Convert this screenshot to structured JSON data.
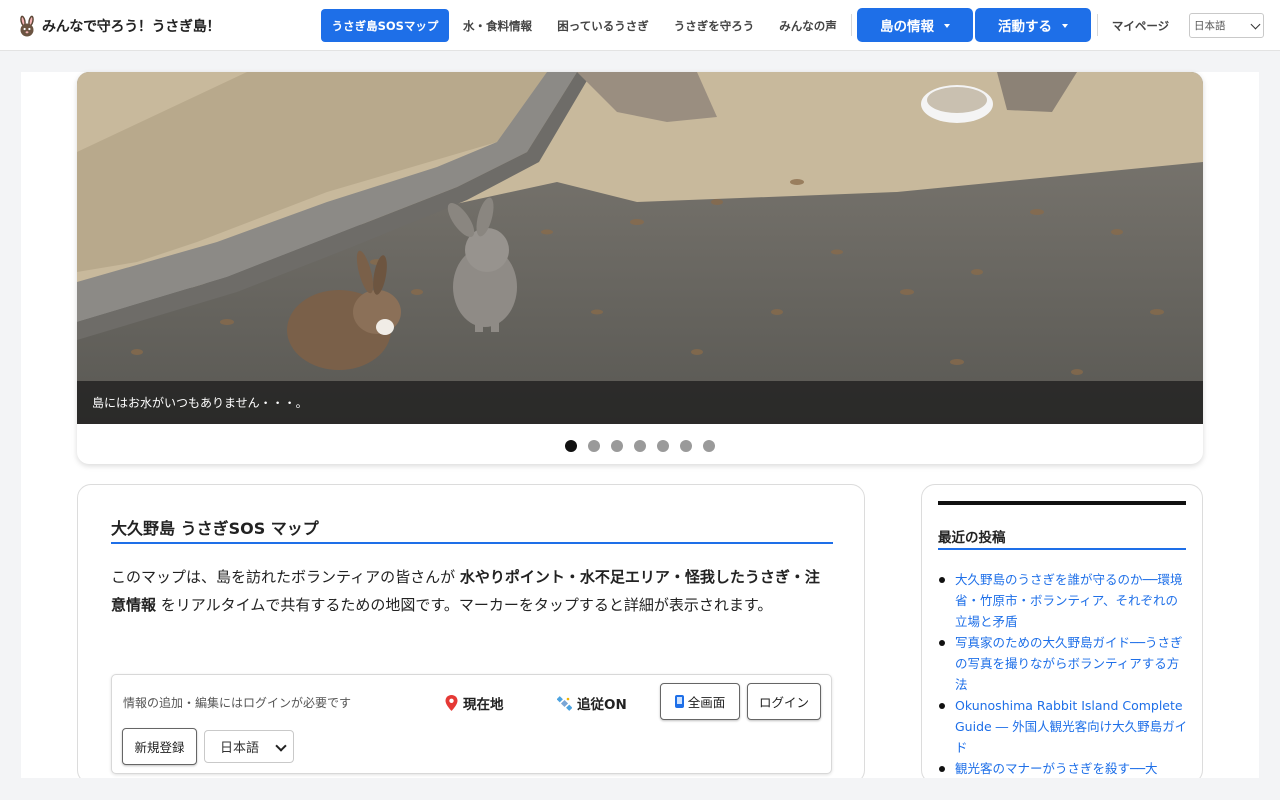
{
  "header": {
    "logo_text": "みんなで守ろう！うさぎ島！",
    "nav": [
      {
        "label": "うさぎ島SOSマップ"
      },
      {
        "label": "水・食料情報"
      },
      {
        "label": "困っているうさぎ"
      },
      {
        "label": "うさぎを守ろう"
      },
      {
        "label": "みんなの声"
      }
    ],
    "dropdowns": [
      {
        "label": "島の情報"
      },
      {
        "label": "活動する"
      }
    ],
    "mypage": "マイページ",
    "language": "日本語"
  },
  "hero": {
    "caption": "島にはお水がいつもありません・・・。",
    "slide_count": 7,
    "active_slide": 1
  },
  "main": {
    "title": "大久野島 うさぎSOS マップ",
    "intro_1": "このマップは、島を訪れたボランティアの皆さんが ",
    "intro_bold": "水やりポイント・水不足エリア・怪我したうさぎ・注意情報",
    "intro_2": " をリアルタイムで共有するための地図です。マーカーをタップすると詳細が表示されます。",
    "map": {
      "login_note": "情報の追加・編集にはログインが必要です",
      "locate_label": "現在地",
      "follow_label": "追従ON",
      "fullscreen_label": "全画面",
      "login_label": "ログイン",
      "register_label": "新規登録",
      "language": "日本語"
    }
  },
  "sidebar": {
    "title": "最近の投稿",
    "posts": [
      "大久野島のうさぎを誰が守るのか──環境省・竹原市・ボランティア、それぞれの立場と矛盾",
      "写真家のための大久野島ガイド──うさぎの写真を撮りながらボランティアする方法",
      "Okunoshima Rabbit Island Complete Guide ― 外国人観光客向け大久野島ガイド",
      "観光客のマナーがうさぎを殺す──大"
    ]
  },
  "colors": {
    "accent": "#1e6fe8",
    "caption_bg": "#191919"
  }
}
